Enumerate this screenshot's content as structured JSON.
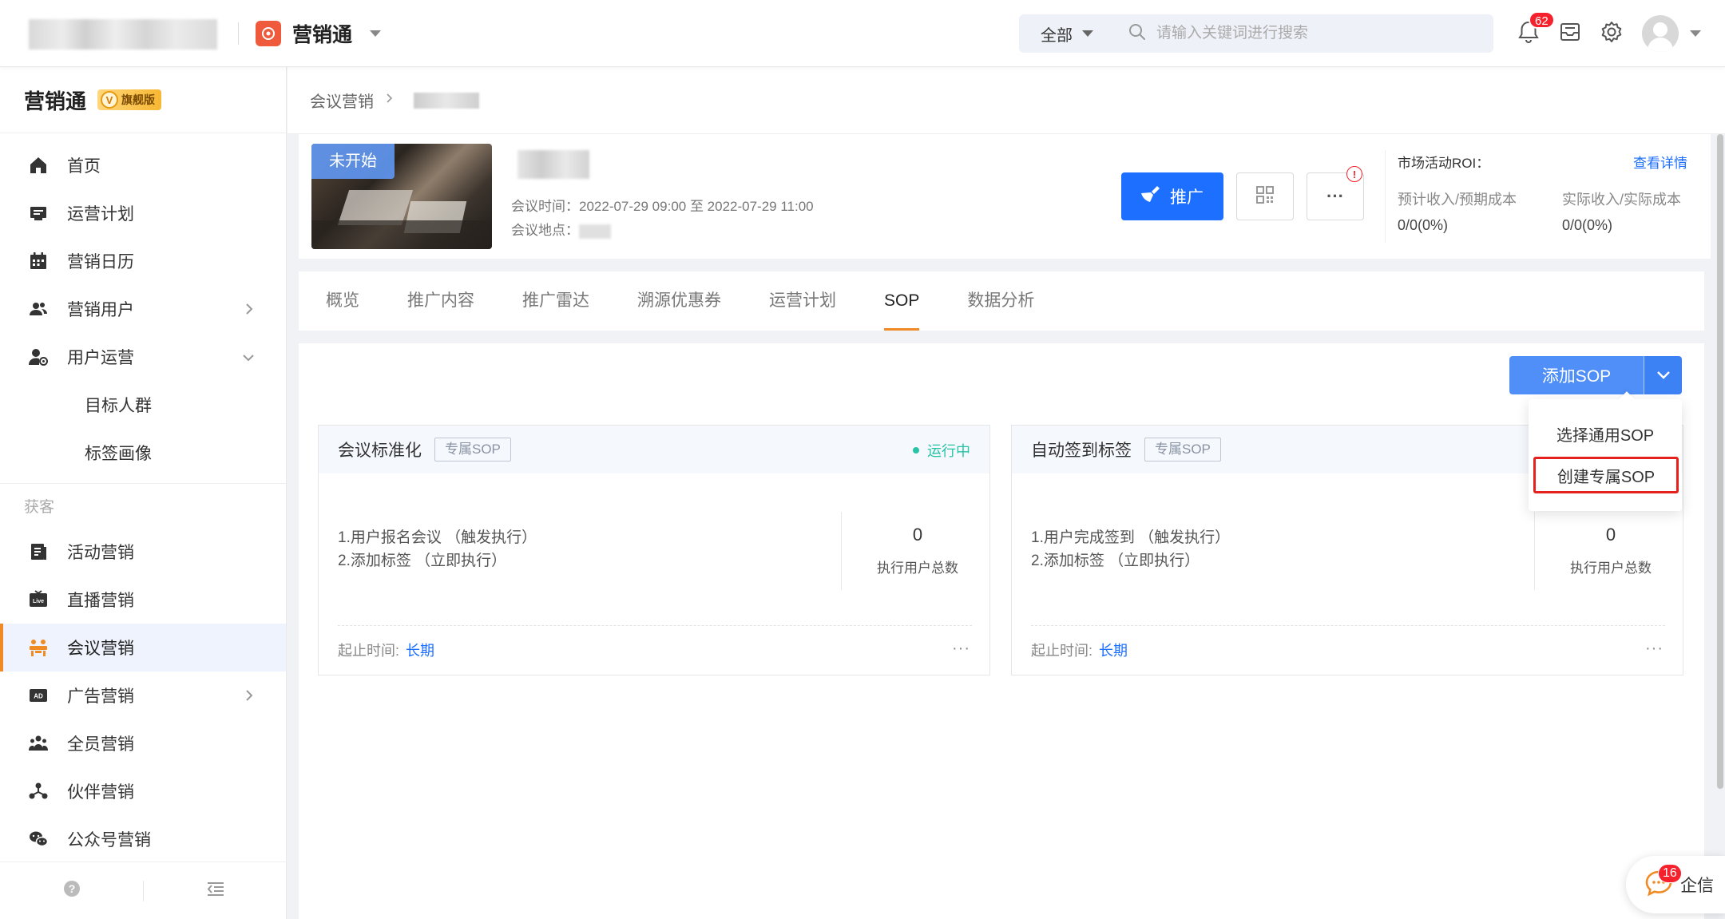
{
  "header": {
    "app_name": "营销通",
    "search": {
      "scope": "全部",
      "placeholder": "请输入关键词进行搜索"
    },
    "notifications_count": "62",
    "icons": [
      "bell-icon",
      "inbox-icon",
      "gear-icon",
      "user-avatar"
    ]
  },
  "sidebar": {
    "title": "营销通",
    "edition_badge": "旗舰版",
    "edition_badge_letter": "V",
    "items": [
      {
        "label": "首页",
        "icon": "home-icon"
      },
      {
        "label": "运营计划",
        "icon": "plan-icon"
      },
      {
        "label": "营销日历",
        "icon": "calendar-icon"
      },
      {
        "label": "营销用户",
        "icon": "users-icon",
        "chevron": "right"
      },
      {
        "label": "用户运营",
        "icon": "user-ops-icon",
        "chevron": "down"
      }
    ],
    "sub_items": [
      {
        "label": "目标人群"
      },
      {
        "label": "标签画像"
      }
    ],
    "group_label": "获客",
    "group_items": [
      {
        "label": "活动营销",
        "icon": "activity-icon"
      },
      {
        "label": "直播营销",
        "icon": "live-icon"
      },
      {
        "label": "会议营销",
        "icon": "meeting-icon",
        "active": true
      },
      {
        "label": "广告营销",
        "icon": "ad-icon",
        "chevron": "right"
      },
      {
        "label": "全员营销",
        "icon": "team-icon"
      },
      {
        "label": "伙伴营销",
        "icon": "partner-icon"
      },
      {
        "label": "公众号营销",
        "icon": "wechat-icon"
      }
    ],
    "footer_icons": [
      "help-icon",
      "collapse-icon"
    ]
  },
  "breadcrumb": {
    "parent": "会议营销"
  },
  "event": {
    "status": "未开始",
    "time_label": "会议时间：",
    "time_value": "2022-07-29 09:00 至 2022-07-29 11:00",
    "location_label": "会议地点：",
    "promote_button": "推广",
    "more_symbol": "···",
    "alert_symbol": "!"
  },
  "roi": {
    "title": "市场活动ROI：",
    "detail_link": "查看详情",
    "col1_label": "预计收入/预期成本",
    "col1_value": "0/0(0%)",
    "col2_label": "实际收入/实际成本",
    "col2_value": "0/0(0%)"
  },
  "tabs": [
    {
      "label": "概览"
    },
    {
      "label": "推广内容"
    },
    {
      "label": "推广雷达"
    },
    {
      "label": "溯源优惠券"
    },
    {
      "label": "运营计划"
    },
    {
      "label": "SOP",
      "active": true
    },
    {
      "label": "数据分析"
    }
  ],
  "add_sop": {
    "label": "添加SOP",
    "menu": [
      {
        "label": "选择通用SOP"
      },
      {
        "label": "创建专属SOP",
        "highlighted": true
      }
    ]
  },
  "sop_cards": [
    {
      "name": "会议标准化",
      "tag": "专属SOP",
      "status": "运行中",
      "step1": "1.用户报名会议 （触发执行）",
      "step2": "2.添加标签 （立即执行）",
      "count": "0",
      "count_label": "执行用户总数",
      "time_label": "起止时间:",
      "time_value": "长期",
      "more": "···"
    },
    {
      "name": "自动签到标签",
      "tag": "专属SOP",
      "status": "",
      "step1": "1.用户完成签到 （触发执行）",
      "step2": "2.添加标签 （立即执行）",
      "count": "0",
      "count_label": "执行用户总数",
      "time_label": "起止时间:",
      "time_value": "长期",
      "more": "···"
    }
  ],
  "float_chat": {
    "label": "企信",
    "count": "16"
  },
  "colors": {
    "primary": "#1c6fff",
    "accent": "#f08a24",
    "running": "#27c3a4",
    "highlight_border": "#e5211d"
  }
}
